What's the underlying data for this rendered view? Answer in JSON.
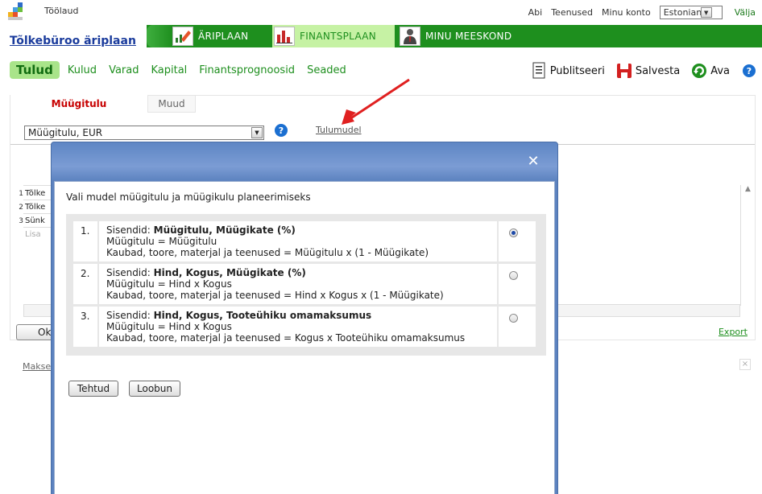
{
  "topbar": {
    "home": "Töölaud",
    "nav": [
      "Abi",
      "Teenused",
      "Minu konto"
    ],
    "language": "Estonian",
    "logout": "Välja"
  },
  "plan": {
    "title": "Tõlkebüroo äriplaan"
  },
  "modules": [
    {
      "label": "ÄRIPLAAN",
      "icon": "pencil-chart-icon"
    },
    {
      "label": "FINANTSPLAAN",
      "icon": "bar-chart-icon"
    },
    {
      "label": "MINU MEESKOND",
      "icon": "person-icon"
    }
  ],
  "subnav": {
    "active": "Tulud",
    "items": [
      "Kulud",
      "Varad",
      "Kapital",
      "Finantsprognoosid",
      "Seaded"
    ]
  },
  "actions": {
    "publish": "Publitseeri",
    "save": "Salvesta",
    "open": "Ava",
    "help": "?"
  },
  "panel": {
    "tabs": [
      "Müügitulu",
      "Muud"
    ],
    "dropdown": "Müügitulu, EUR",
    "model_link": "Tulumudel",
    "rows": [
      {
        "num": "1",
        "text": "Tõlke"
      },
      {
        "num": "2",
        "text": "Tõlke"
      },
      {
        "num": "3",
        "text": "Sünk"
      }
    ],
    "add_row": "Lisa",
    "ok": "Ok",
    "export": "Export",
    "makse": "Makse"
  },
  "modal": {
    "intro": "Vali mudel müügitulu ja müügikulu planeerimiseks",
    "options": [
      {
        "num": "1.",
        "prefix": "Sisendid: ",
        "inputs": "Müügitulu, Müügikate (%)",
        "line1": "Müügitulu = Müügitulu",
        "line2": "Kaubad, toore, materjal ja teenused = Müügitulu x (1 - Müügikate)",
        "selected": true
      },
      {
        "num": "2.",
        "prefix": "Sisendid: ",
        "inputs": "Hind, Kogus, Müügikate (%)",
        "line1": "Müügitulu = Hind x Kogus",
        "line2": "Kaubad, toore, materjal ja teenused = Hind x Kogus x (1 - Müügikate)",
        "selected": false
      },
      {
        "num": "3.",
        "prefix": "Sisendid: ",
        "inputs": "Hind, Kogus, Tooteühiku omamaksumus",
        "line1": "Müügitulu = Hind x Kogus",
        "line2": "Kaubad, toore, materjal ja teenused = Kogus x Tooteühiku omamaksumus",
        "selected": false
      }
    ],
    "done": "Tehtud",
    "cancel": "Loobun"
  },
  "colors": {
    "green": "#1e8f1e",
    "active_module": "#c6f2a4",
    "modal_header": "#6e92cd",
    "tab_active": "#c70000"
  }
}
